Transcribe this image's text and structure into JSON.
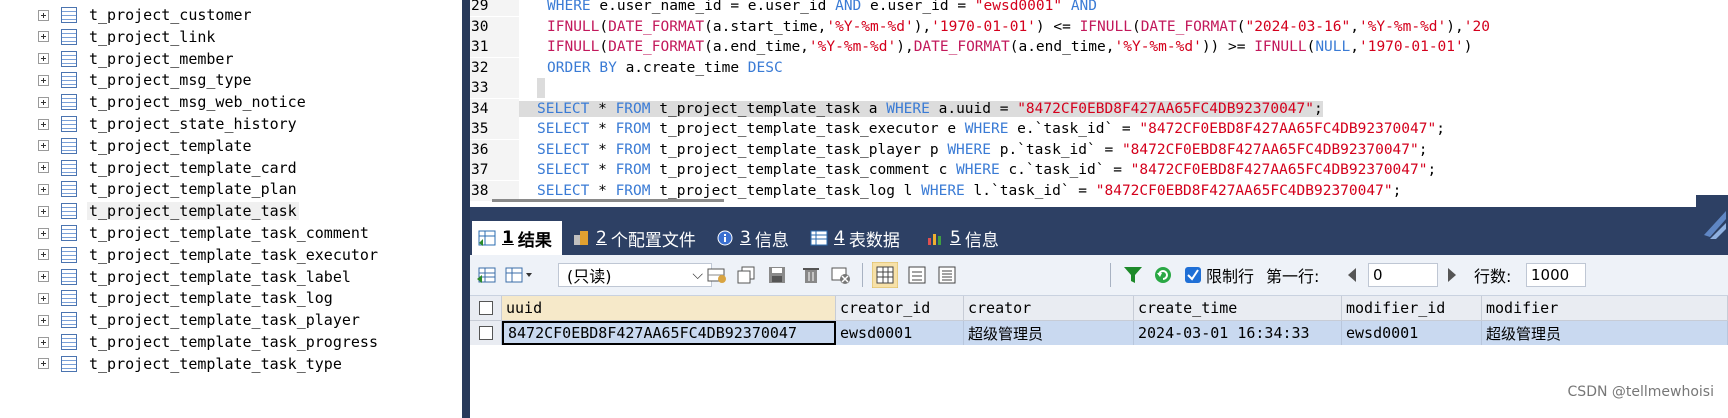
{
  "tree": {
    "items": [
      {
        "label": "t_project_customer"
      },
      {
        "label": "t_project_link"
      },
      {
        "label": "t_project_member"
      },
      {
        "label": "t_project_msg_type"
      },
      {
        "label": "t_project_msg_web_notice"
      },
      {
        "label": "t_project_state_history"
      },
      {
        "label": "t_project_template"
      },
      {
        "label": "t_project_template_card"
      },
      {
        "label": "t_project_template_plan"
      },
      {
        "label": "t_project_template_task",
        "selected": true
      },
      {
        "label": "t_project_template_task_comment"
      },
      {
        "label": "t_project_template_task_executor"
      },
      {
        "label": "t_project_template_task_label"
      },
      {
        "label": "t_project_template_task_log"
      },
      {
        "label": "t_project_template_task_player"
      },
      {
        "label": "t_project_template_task_progress"
      },
      {
        "label": "t_project_template_task_type"
      }
    ]
  },
  "editor": {
    "lines": [
      {
        "num": "29",
        "tokens": [
          {
            "t": "kw",
            "v": "WHERE "
          },
          {
            "t": "",
            "v": "e.user_name_id = e.user_id "
          },
          {
            "t": "kw",
            "v": "AND "
          },
          {
            "t": "",
            "v": "e.user_id = "
          },
          {
            "t": "str",
            "v": "\"ewsd0001\" "
          },
          {
            "t": "kw",
            "v": "AND"
          }
        ]
      },
      {
        "num": "30",
        "tokens": [
          {
            "t": "fn",
            "v": "IFNULL"
          },
          {
            "t": "",
            "v": "("
          },
          {
            "t": "fn",
            "v": "DATE_FORMAT"
          },
          {
            "t": "",
            "v": "(a.start_time,"
          },
          {
            "t": "str",
            "v": "'%Y-%m-%d'"
          },
          {
            "t": "",
            "v": "),"
          },
          {
            "t": "str",
            "v": "'1970-01-01'"
          },
          {
            "t": "",
            "v": ") <= "
          },
          {
            "t": "fn",
            "v": "IFNULL"
          },
          {
            "t": "",
            "v": "("
          },
          {
            "t": "fn",
            "v": "DATE_FORMAT"
          },
          {
            "t": "",
            "v": "("
          },
          {
            "t": "str",
            "v": "\"2024-03-16\""
          },
          {
            "t": "",
            "v": ","
          },
          {
            "t": "str",
            "v": "'%Y-%m-%d'"
          },
          {
            "t": "",
            "v": "),"
          },
          {
            "t": "str",
            "v": "'20"
          }
        ]
      },
      {
        "num": "31",
        "tokens": [
          {
            "t": "fn",
            "v": "IFNULL"
          },
          {
            "t": "",
            "v": "("
          },
          {
            "t": "fn",
            "v": "DATE_FORMAT"
          },
          {
            "t": "",
            "v": "(a.end_time,"
          },
          {
            "t": "str",
            "v": "'%Y-%m-%d'"
          },
          {
            "t": "",
            "v": "),"
          },
          {
            "t": "fn",
            "v": "DATE_FORMAT"
          },
          {
            "t": "",
            "v": "(a.end_time,"
          },
          {
            "t": "str",
            "v": "'%Y-%m-%d'"
          },
          {
            "t": "",
            "v": ")) >= "
          },
          {
            "t": "fn",
            "v": "IFNULL"
          },
          {
            "t": "",
            "v": "("
          },
          {
            "t": "kw",
            "v": "NULL"
          },
          {
            "t": "",
            "v": ","
          },
          {
            "t": "str",
            "v": "'1970-01-01'"
          },
          {
            "t": "",
            "v": ")"
          }
        ]
      },
      {
        "num": "32",
        "tokens": [
          {
            "t": "kw",
            "v": "ORDER BY "
          },
          {
            "t": "",
            "v": "a.create_time "
          },
          {
            "t": "kw",
            "v": "DESC"
          }
        ]
      },
      {
        "num": "33",
        "tokens": []
      },
      {
        "num": "34",
        "tokens": [
          {
            "t": "kw",
            "v": "SELECT "
          },
          {
            "t": "",
            "v": "* "
          },
          {
            "t": "kw",
            "v": "FROM "
          },
          {
            "t": "",
            "v": "t_project_template_task a "
          },
          {
            "t": "kw",
            "v": "WHERE "
          },
          {
            "t": "",
            "v": "a.uuid = "
          },
          {
            "t": "str",
            "v": "\"8472CF0EBD8F427AA65FC4DB92370047\""
          },
          {
            "t": "",
            "v": ";"
          }
        ]
      },
      {
        "num": "35",
        "tokens": [
          {
            "t": "kw",
            "v": "SELECT "
          },
          {
            "t": "",
            "v": "* "
          },
          {
            "t": "kw",
            "v": "FROM "
          },
          {
            "t": "",
            "v": "t_project_template_task_executor e "
          },
          {
            "t": "kw",
            "v": "WHERE "
          },
          {
            "t": "",
            "v": "e.`task_id` = "
          },
          {
            "t": "str",
            "v": "\"8472CF0EBD8F427AA65FC4DB92370047\""
          },
          {
            "t": "",
            "v": ";"
          }
        ]
      },
      {
        "num": "36",
        "tokens": [
          {
            "t": "kw",
            "v": "SELECT "
          },
          {
            "t": "",
            "v": "* "
          },
          {
            "t": "kw",
            "v": "FROM "
          },
          {
            "t": "",
            "v": "t_project_template_task_player p "
          },
          {
            "t": "kw",
            "v": "WHERE "
          },
          {
            "t": "",
            "v": "p.`task_id` = "
          },
          {
            "t": "str",
            "v": "\"8472CF0EBD8F427AA65FC4DB92370047\""
          },
          {
            "t": "",
            "v": ";"
          }
        ]
      },
      {
        "num": "37",
        "tokens": [
          {
            "t": "kw",
            "v": "SELECT "
          },
          {
            "t": "",
            "v": "* "
          },
          {
            "t": "kw",
            "v": "FROM "
          },
          {
            "t": "",
            "v": "t_project_template_task_comment c "
          },
          {
            "t": "kw",
            "v": "WHERE "
          },
          {
            "t": "",
            "v": "c.`task_id` = "
          },
          {
            "t": "str",
            "v": "\"8472CF0EBD8F427AA65FC4DB92370047\""
          },
          {
            "t": "",
            "v": ";"
          }
        ]
      },
      {
        "num": "38",
        "tokens": [
          {
            "t": "kw",
            "v": "SELECT "
          },
          {
            "t": "",
            "v": "* "
          },
          {
            "t": "kw",
            "v": "FROM "
          },
          {
            "t": "",
            "v": "t_project_template_task_log l "
          },
          {
            "t": "kw",
            "v": "WHERE "
          },
          {
            "t": "",
            "v": "l.`task_id` = "
          },
          {
            "t": "str",
            "v": "\"8472CF0EBD8F427AA65FC4DB92370047\""
          },
          {
            "t": "",
            "v": ";"
          }
        ]
      }
    ],
    "highlight_line": "34",
    "colors": {
      "keyword": "#3a7bd5",
      "function": "#c2185b",
      "string": "#d4001c"
    }
  },
  "tabs": [
    {
      "num": "1",
      "label": "结果",
      "icon": "result-table-icon",
      "active": true
    },
    {
      "num": "2",
      "label": "个配置文件",
      "icon": "profile-icon"
    },
    {
      "num": "3",
      "label": "信息",
      "icon": "info-icon"
    },
    {
      "num": "4",
      "label": "表数据",
      "icon": "table-data-icon"
    },
    {
      "num": "5",
      "label": "信息",
      "icon": "info-chart-icon"
    }
  ],
  "toolbar": {
    "mode": "(只读)",
    "limit_label": "限制行",
    "first_row_label": "第一行:",
    "first_row_value": "0",
    "rows_label": "行数:",
    "rows_value": "1000",
    "limit_checked": true
  },
  "grid": {
    "columns": [
      "uuid",
      "creator_id",
      "creator",
      "create_time",
      "modifier_id",
      "modifier"
    ],
    "rows": [
      [
        "8472CF0EBD8F427AA65FC4DB92370047",
        "ewsd0001",
        "超级管理员",
        "2024-03-01 16:34:33",
        "ewsd0001",
        "超级管理员"
      ]
    ]
  },
  "watermark": "CSDN @tellmewhoisi"
}
